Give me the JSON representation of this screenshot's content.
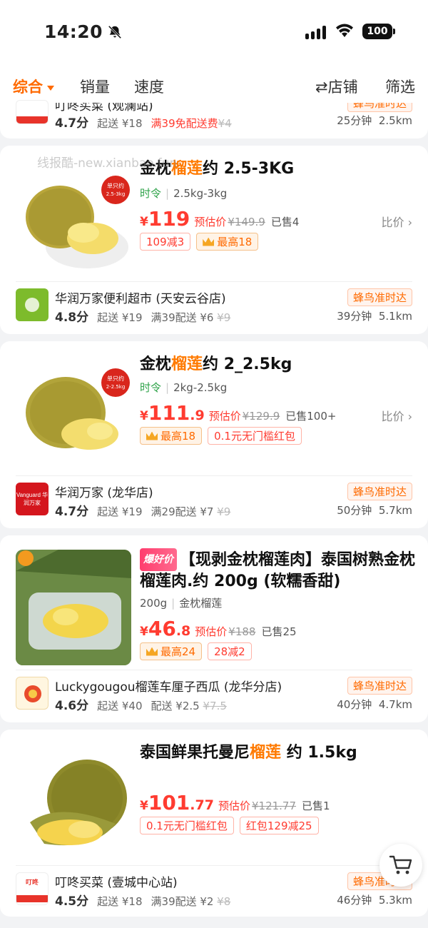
{
  "status_bar": {
    "time": "14:20",
    "battery": "100"
  },
  "sort_bar": {
    "tabs": [
      "综合",
      "销量",
      "速度"
    ],
    "store_label": "⇄店铺",
    "filter_label": "筛选"
  },
  "top_partial_store": {
    "name": "叮咚买菜 (观澜站)",
    "score": "4.7分",
    "min_order": "起送 ¥18",
    "promo": "满39免配送费",
    "fee_old": "¥4",
    "badge": "蜂鸟准时达",
    "eta": "25分钟",
    "distance": "2.5km"
  },
  "watermark": "线报酷-new.xianbao.fun",
  "products": [
    {
      "title_pre": "金枕",
      "title_hl": "榴莲",
      "title_post": "约 2.5-3KG",
      "brand": "时令",
      "spec": "2.5kg-3kg",
      "price_int": "119",
      "price_dec": "",
      "est_label": "预估价",
      "orig_price": "¥149.9",
      "sold": "已售4",
      "compare": "比价 ›",
      "tags": [
        "109减3",
        "最高18"
      ],
      "sticker": "单只约 2.5-3kg",
      "store": {
        "name": "华润万家便利超市 (天安云谷店)",
        "score": "4.8分",
        "min_order": "起送 ¥19",
        "delivery": "满39配送 ¥6",
        "fee_old": "¥9",
        "badge": "蜂鸟准时达",
        "eta": "39分钟",
        "distance": "5.1km"
      }
    },
    {
      "title_pre": "金枕",
      "title_hl": "榴莲",
      "title_post": "约 2_2.5kg",
      "brand": "时令",
      "spec": "2kg-2.5kg",
      "price_int": "111",
      "price_dec": ".9",
      "est_label": "预估价",
      "orig_price": "¥129.9",
      "sold": "已售100+",
      "compare": "比价 ›",
      "tags": [
        "最高18",
        "0.1元无门槛红包"
      ],
      "sticker": "单只约 2-2.5kg",
      "store": {
        "name": "华润万家 (龙华店)",
        "logo_text": "Vanguard 华润万家",
        "score": "4.7分",
        "min_order": "起送 ¥19",
        "delivery": "满29配送 ¥7",
        "fee_old": "¥9",
        "badge": "蜂鸟准时达",
        "eta": "50分钟",
        "distance": "5.7km"
      }
    },
    {
      "hot_label": "爆好价",
      "title": "【现剥金枕榴莲肉】泰国树熟金枕榴莲肉.约 200g (软糯香甜)",
      "spec_a": "200g",
      "spec_b": "金枕榴莲",
      "price_int": "46",
      "price_dec": ".8",
      "est_label": "预估价",
      "orig_price": "¥188",
      "sold": "已售25",
      "tags": [
        "最高24",
        "28减2"
      ],
      "store": {
        "name": "Luckygougou榴莲车厘子西瓜 (龙华分店)",
        "score": "4.6分",
        "min_order": "起送 ¥40",
        "delivery": "配送 ¥2.5",
        "fee_old": "¥7.5",
        "badge": "蜂鸟准时达",
        "eta": "40分钟",
        "distance": "4.7km"
      }
    },
    {
      "title_pre": "泰国鲜果托曼尼",
      "title_hl": "榴莲",
      "title_post": " 约 1.5kg",
      "price_int": "101",
      "price_dec": ".77",
      "est_label": "预估价",
      "orig_price": "¥121.77",
      "sold": "已售1",
      "tags": [
        "0.1元无门槛红包",
        "红包129减25"
      ],
      "store": {
        "name": "叮咚买菜 (壹城中心站)",
        "score": "4.5分",
        "min_order": "起送 ¥18",
        "delivery": "满39配送 ¥2",
        "fee_old": "¥8",
        "badge": "蜂鸟准时达",
        "eta": "46分钟",
        "distance": "5.3km"
      }
    }
  ],
  "colors": {
    "accent": "#ff6a00",
    "price": "#ff3b30",
    "brand_green": "#2fa34a"
  }
}
